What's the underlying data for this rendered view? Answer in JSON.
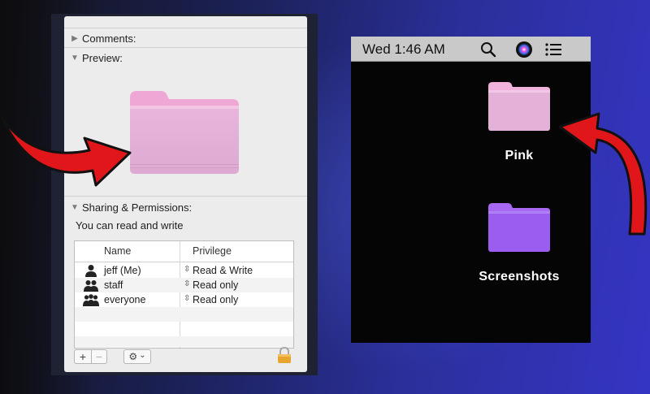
{
  "info_panel": {
    "comments_label": "Comments:",
    "preview_label": "Preview:",
    "sharing_label": "Sharing & Permissions:",
    "permission_summary": "You can read and write",
    "table": {
      "header_name": "Name",
      "header_privilege": "Privilege",
      "rows": [
        {
          "name": "jeff (Me)",
          "privilege": "Read & Write",
          "icon": "single-user-icon"
        },
        {
          "name": "staff",
          "privilege": "Read only",
          "icon": "group-users-icon"
        },
        {
          "name": "everyone",
          "privilege": "Read only",
          "icon": "everyone-users-icon"
        }
      ]
    },
    "controls": {
      "add_symbol": "+",
      "remove_symbol": "−",
      "action_symbol": "⚙",
      "action_chevron": "⌄"
    },
    "preview_folder_color": "#e7a9d2"
  },
  "desktop": {
    "menubar": {
      "clock": "Wed 1:46 AM",
      "icons": [
        "search-icon",
        "siri-icon",
        "notification-center-icon"
      ]
    },
    "folders": [
      {
        "label": "Pink",
        "color": "#e6b3dc"
      },
      {
        "label": "Screenshots",
        "color": "#9e5ff0"
      }
    ]
  },
  "annotations": {
    "arrow_color": "#e0161b",
    "left_arrow_points_to": "preview-folder",
    "right_arrow_points_to": "desktop-folder-pink"
  }
}
